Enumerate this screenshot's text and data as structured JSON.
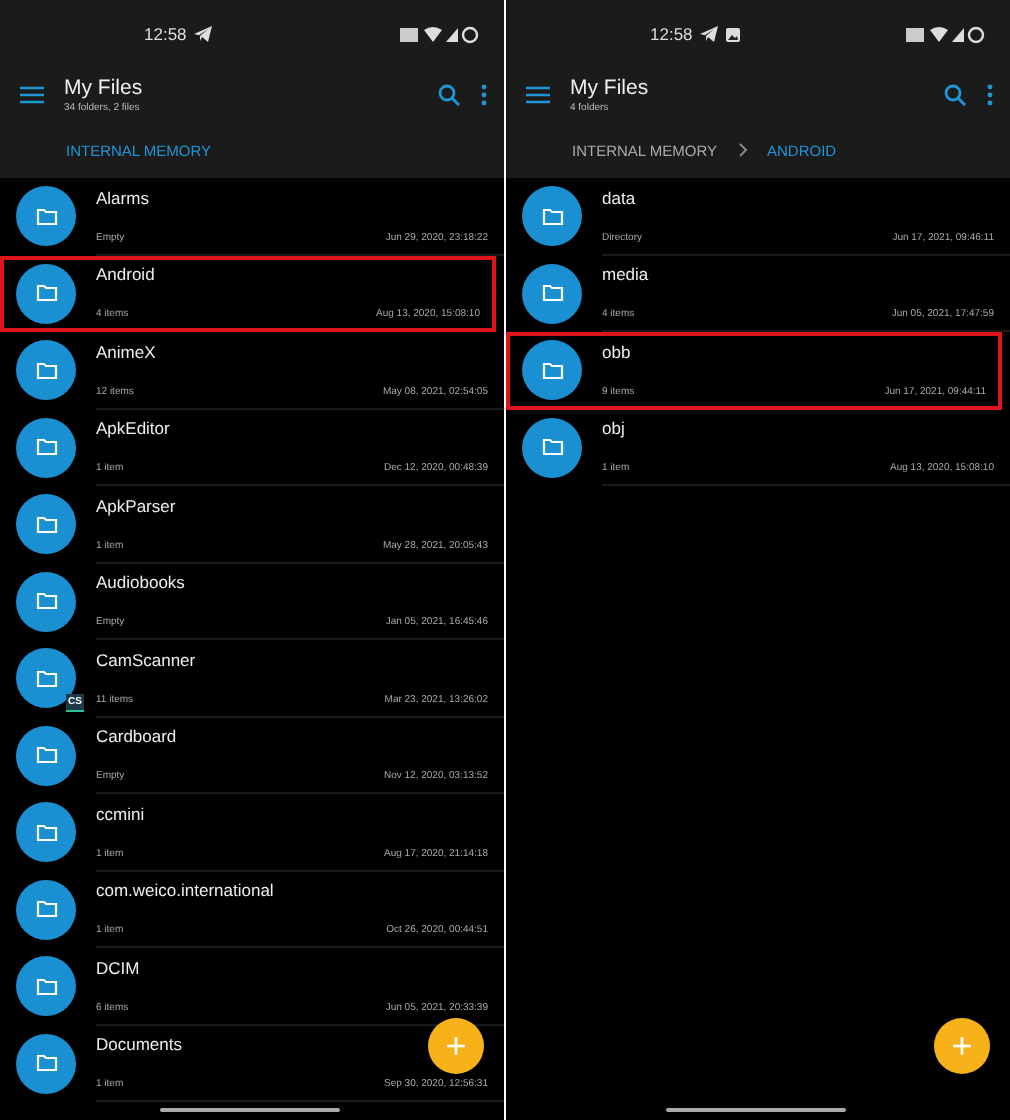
{
  "screens": [
    {
      "status_bar": {
        "time": "12:58",
        "notifications": [
          {
            "kind": "telegram"
          }
        ]
      },
      "title": "My Files",
      "subtitle": "34 folders, 2 files",
      "breadcrumbs": [
        {
          "label": "INTERNAL MEMORY",
          "selected": true
        }
      ],
      "folders": [
        {
          "name": "Alarms",
          "info": "Empty",
          "date": "Jun 29, 2020, 23:18:22",
          "highlighted": false
        },
        {
          "name": "Android",
          "info": "4 items",
          "date": "Aug 13, 2020, 15:08:10",
          "highlighted": true
        },
        {
          "name": "AnimeX",
          "info": "12 items",
          "date": "May 08, 2021, 02:54:05",
          "highlighted": false
        },
        {
          "name": "ApkEditor",
          "info": "1 item",
          "date": "Dec 12, 2020, 00:48:39",
          "highlighted": false
        },
        {
          "name": "ApkParser",
          "info": "1 item",
          "date": "May 28, 2021, 20:05:43",
          "highlighted": false
        },
        {
          "name": "Audiobooks",
          "info": "Empty",
          "date": "Jan 05, 2021, 16:45:46",
          "highlighted": false
        },
        {
          "name": "CamScanner",
          "info": "11 items",
          "date": "Mar 23, 2021, 13:26:02",
          "highlighted": false,
          "badge": "CS"
        },
        {
          "name": "Cardboard",
          "info": "Empty",
          "date": "Nov 12, 2020, 03:13:52",
          "highlighted": false
        },
        {
          "name": "ccmini",
          "info": "1 item",
          "date": "Aug 17, 2020, 21:14:18",
          "highlighted": false
        },
        {
          "name": "com.weico.international",
          "info": "1 item",
          "date": "Oct 26, 2020, 00:44:51",
          "highlighted": false
        },
        {
          "name": "DCIM",
          "info": "6 items",
          "date": "Jun 05, 2021, 20:33:39",
          "highlighted": false
        },
        {
          "name": "Documents",
          "info": "1 item",
          "date": "Sep 30, 2020, 12:56:31",
          "highlighted": false
        }
      ],
      "fab": "+"
    },
    {
      "status_bar": {
        "time": "12:58",
        "notifications": [
          {
            "kind": "telegram"
          },
          {
            "kind": "image"
          }
        ]
      },
      "title": "My Files",
      "subtitle": "4 folders",
      "breadcrumbs": [
        {
          "label": "INTERNAL MEMORY",
          "selected": false
        },
        {
          "label": "ANDROID",
          "selected": true
        }
      ],
      "folders": [
        {
          "name": "data",
          "info": "Directory",
          "date": "Jun 17, 2021, 09:46:11",
          "highlighted": false
        },
        {
          "name": "media",
          "info": "4 items",
          "date": "Jun 05, 2021, 17:47:59",
          "highlighted": false
        },
        {
          "name": "obb",
          "info": "9 items",
          "date": "Jun 17, 2021, 09:44:11",
          "highlighted": true
        },
        {
          "name": "obj",
          "info": "1 item",
          "date": "Aug 13, 2020, 15:08:10",
          "highlighted": false
        }
      ],
      "fab": "+"
    }
  ]
}
